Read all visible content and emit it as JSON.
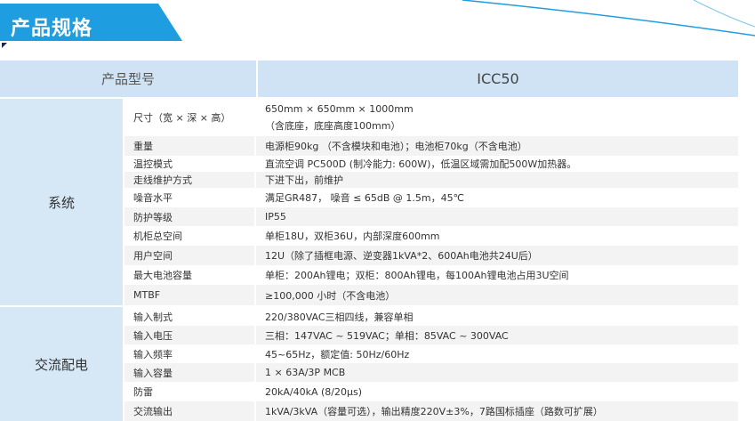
{
  "header": {
    "title": "产品规格"
  },
  "table": {
    "head_label": "产品型号",
    "head_value": "ICC50",
    "groups": [
      {
        "name": "系统",
        "rows": [
          {
            "label": "尺寸（宽 × 深 × 高）",
            "value": "650mm × 650mm × 1000mm",
            "value2": "（含底座，底座高度100mm）"
          },
          {
            "label": "重量",
            "value": "电源柜90kg （不含模块和电池）；电池柜70kg（不含电池）"
          },
          {
            "label": "温控模式",
            "value": "直流空调 PC500D (制冷能力: 600W)，低温区域需加配500W加热器。"
          },
          {
            "label": "走线维护方式",
            "value": "下进下出，前维护"
          },
          {
            "label": "噪音水平",
            "value": "满足GR487， 噪音 ≤ 65dB @ 1.5m，45℃"
          },
          {
            "label": "防护等级",
            "value": "IP55"
          },
          {
            "label": "机柜总空间",
            "value": "单柜18U，双柜36U，内部深度600mm"
          },
          {
            "label": "用户空间",
            "value": "12U（除了插框电源、逆变器1kVA*2、600Ah电池共24U后）"
          },
          {
            "label": "最大电池容量",
            "value": "单柜：200Ah锂电；双柜：800Ah锂电，每100Ah锂电池占用3U空间"
          },
          {
            "label": "MTBF",
            "value": "≥100,000 小时（不含电池）"
          }
        ]
      },
      {
        "name": "交流配电",
        "rows": [
          {
            "label": "输入制式",
            "value": "220/380VAC三相四线，兼容单相"
          },
          {
            "label": "输入电压",
            "value": "三相：147VAC ~ 519VAC；单相：85VAC ~ 300VAC"
          },
          {
            "label": "输入频率",
            "value": "45~65Hz，额定值: 50Hz/60Hz"
          },
          {
            "label": "输入容量",
            "value": "1 × 63A/3P MCB"
          },
          {
            "label": "防雷",
            "value": "20kA/40kA (8/20μs)"
          },
          {
            "label": "交流输出",
            "value": "1kVA/3kVA（容量可选），输出精度220V±3%，7路国标插座（路数可扩展）"
          }
        ]
      }
    ]
  },
  "colors": {
    "banner": "#1e9ee0",
    "header_fill": "#cfe3f5",
    "group_fill": "#d6e7f6",
    "stripe": "#f3f3f3"
  }
}
